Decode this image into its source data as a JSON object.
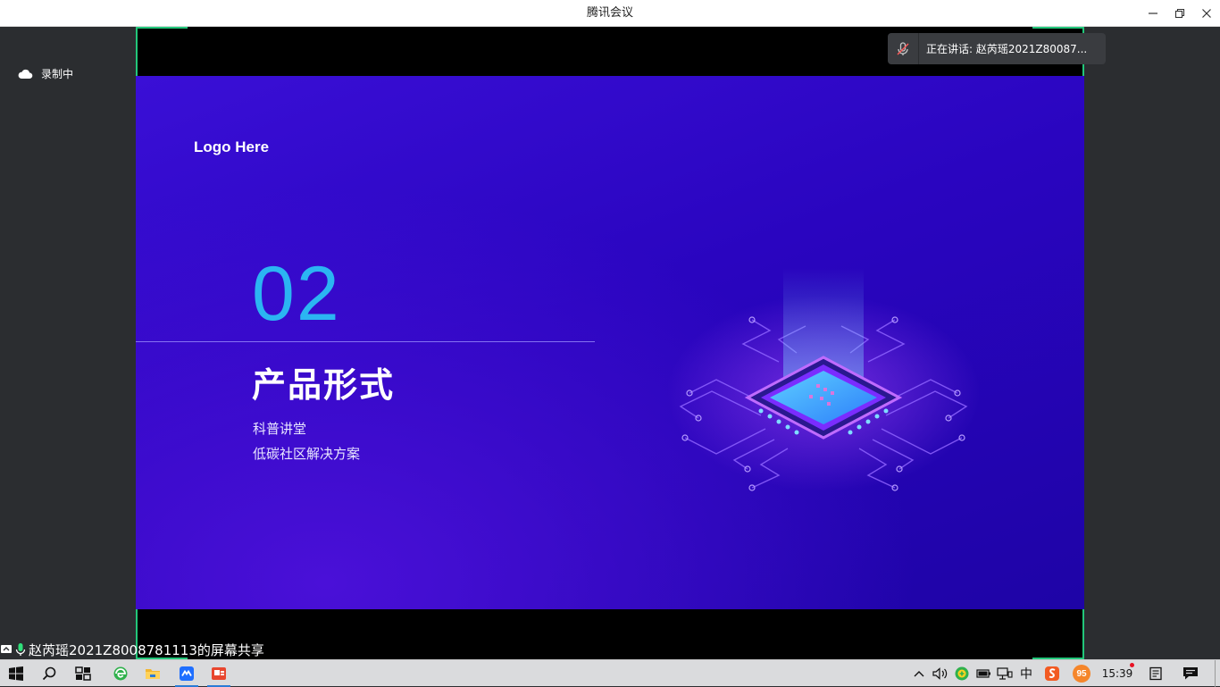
{
  "window": {
    "title": "腾讯会议"
  },
  "recording": {
    "label": "录制中"
  },
  "speaker": {
    "label": "正在讲话: 赵芮瑶2021Z80087..."
  },
  "slide": {
    "logo": "Logo Here",
    "number": "02",
    "heading": "产品形式",
    "items": [
      "科普讲堂",
      "低碳社区解决方案"
    ]
  },
  "share": {
    "label": "赵芮瑶2021Z8008781113的屏幕共享"
  },
  "taskbar": {
    "ime": "中",
    "badge": "95",
    "time": "15:39"
  },
  "colors": {
    "accent_green": "#22c77a",
    "slide_number": "#2bb5f2",
    "slide_bg": "#2a05c0"
  }
}
